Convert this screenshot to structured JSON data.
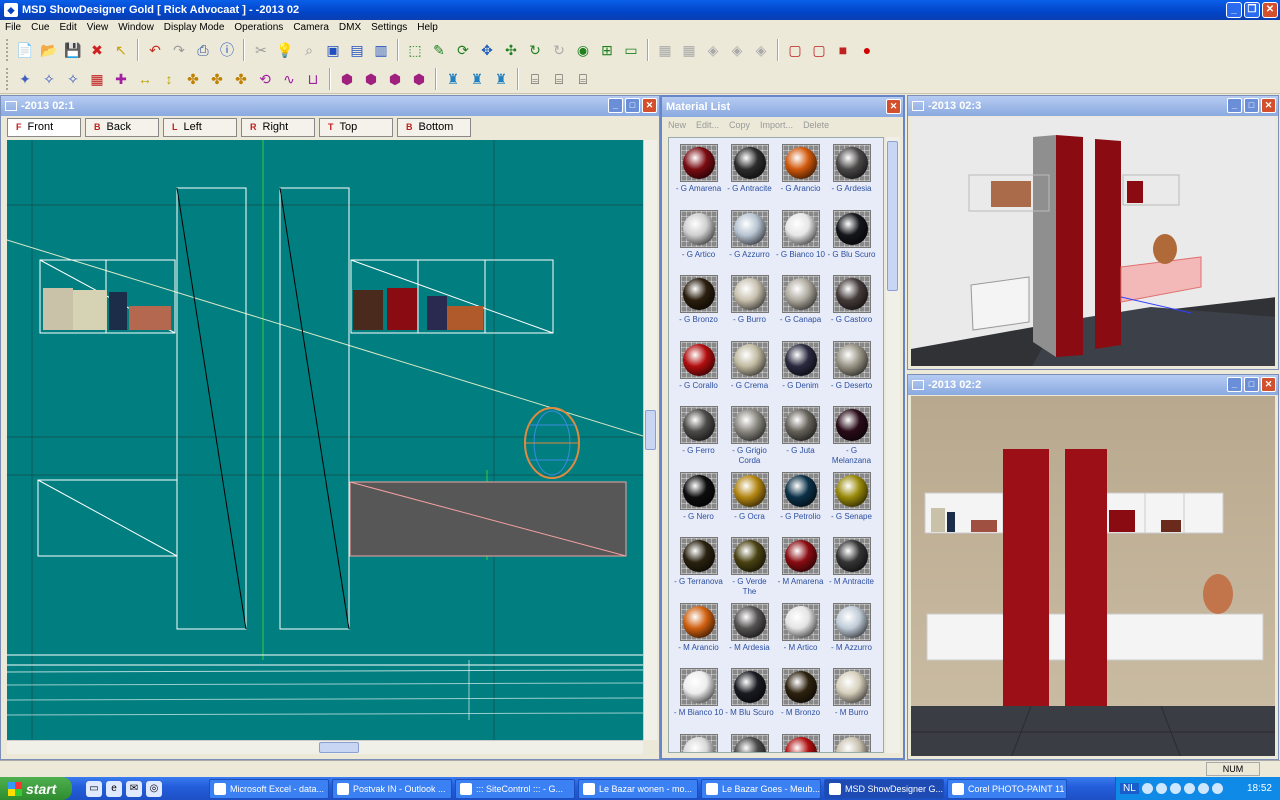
{
  "app": {
    "title": "MSD ShowDesigner Gold [  Rick Advocaat ] - -2013 02",
    "window_buttons": [
      "_",
      "❐",
      "✕"
    ]
  },
  "menu": [
    "File",
    "Cue",
    "Edit",
    "View",
    "Window",
    "Display Mode",
    "Operations",
    "Camera",
    "DMX",
    "Settings",
    "Help"
  ],
  "toolbar1_icons": [
    "new-file-icon",
    "open-folder-icon",
    "save-icon",
    "delete-icon",
    "pointer-icon",
    "undo-icon",
    "redo-icon",
    "print-icon",
    "info-icon",
    "cut-icon",
    "bulb-icon",
    "search-icon",
    "document-icon",
    "camera-doc-icon",
    "book-icon",
    "select-rect-icon",
    "pencil-select-icon",
    "rotate-icon",
    "move-icon",
    "pan-icon",
    "refresh-icon",
    "refresh-disabled-icon",
    "eye-icon",
    "split-view-icon",
    "display-mode-icon",
    "box-icon",
    "box2-icon",
    "shape-icon",
    "shape2-icon",
    "shape3-icon",
    "cube-outline-icon",
    "cube-wire-icon",
    "cube-solid-icon",
    "record-icon"
  ],
  "toolbar2_icons": [
    "fixture-tool-icon",
    "light-tool-icon",
    "light2-icon",
    "grid-tool-icon",
    "move-x-icon",
    "move-h-icon",
    "move-v-icon",
    "align-icon",
    "align2-icon",
    "align3-icon",
    "rotate-tool-icon",
    "path-icon",
    "chart-tool-icon",
    "object-icon",
    "object2-icon",
    "object3-icon",
    "object4-icon",
    "figure-icon",
    "figure2-icon",
    "figure3-icon",
    "truss-icon",
    "truss2-icon",
    "truss3-icon"
  ],
  "viewport1": {
    "title": "-2013 02:1",
    "tabs": [
      {
        "label": "Front",
        "icon": "F"
      },
      {
        "label": "Back",
        "icon": "B"
      },
      {
        "label": "Left",
        "icon": "L"
      },
      {
        "label": "Right",
        "icon": "R"
      },
      {
        "label": "Top",
        "icon": "T"
      },
      {
        "label": "Bottom",
        "icon": "B"
      }
    ]
  },
  "material_list": {
    "title": "Material List",
    "actions": [
      "New",
      "Edit...",
      "Copy",
      "Import...",
      "Delete"
    ],
    "items": [
      {
        "label": "- G Amarena",
        "color": "#7a0c12"
      },
      {
        "label": "- G Antracite",
        "color": "#2d2d2d"
      },
      {
        "label": "- G Arancio",
        "color": "#d2590c"
      },
      {
        "label": "- G Ardesia",
        "color": "#4b4848"
      },
      {
        "label": "- G Artico",
        "color": "#cfcfcf"
      },
      {
        "label": "- G Azzurro",
        "color": "#b7c4d2"
      },
      {
        "label": "- G Bianco 10",
        "color": "#e6e6e6"
      },
      {
        "label": "- G Blu Scuro",
        "color": "#15161c"
      },
      {
        "label": "- G Bronzo",
        "color": "#2a1e0e"
      },
      {
        "label": "- G Burro",
        "color": "#c9c2b0"
      },
      {
        "label": "- G Canapa",
        "color": "#b0aba0"
      },
      {
        "label": "- G Castoro",
        "color": "#453c3a"
      },
      {
        "label": "- G Corallo",
        "color": "#b20e0e"
      },
      {
        "label": "- G Crema",
        "color": "#c2bba2"
      },
      {
        "label": "- G Denim",
        "color": "#2a2a40"
      },
      {
        "label": "- G Deserto",
        "color": "#9a9586"
      },
      {
        "label": "- G Ferro",
        "color": "#4e4c49"
      },
      {
        "label": "- G Grigio Corda",
        "color": "#8c8a82"
      },
      {
        "label": "- G Juta",
        "color": "#66635b"
      },
      {
        "label": "- G Melanzana",
        "color": "#2a0c18"
      },
      {
        "label": "- G Nero",
        "color": "#0d0d0d"
      },
      {
        "label": "- G Ocra",
        "color": "#b38612"
      },
      {
        "label": "- G Petrolio",
        "color": "#0b3148"
      },
      {
        "label": "- G Senape",
        "color": "#9a8a0a"
      },
      {
        "label": "- G Terranova",
        "color": "#2a2210"
      },
      {
        "label": "- G Verde The",
        "color": "#4a4212"
      },
      {
        "label": "- M Amarena",
        "color": "#8a0c12"
      },
      {
        "label": "- M Antracite",
        "color": "#353535"
      },
      {
        "label": "- M Arancio",
        "color": "#d06010"
      },
      {
        "label": "- M Ardesia",
        "color": "#555252"
      },
      {
        "label": "- M Artico",
        "color": "#e4e4e4"
      },
      {
        "label": "- M Azzurro",
        "color": "#c0ccd8"
      },
      {
        "label": "- M Bianco 10",
        "color": "#ededed"
      },
      {
        "label": "- M Blu Scuro",
        "color": "#1a1b22"
      },
      {
        "label": "- M Bronzo",
        "color": "#2e220f"
      },
      {
        "label": "- M Burro",
        "color": "#d6cfbc"
      }
    ],
    "partial_row_colors": [
      "#d8d8d8",
      "#4a4a4a",
      "#b01010",
      "#c9c2b0"
    ]
  },
  "viewport3": {
    "title": "-2013 02:3"
  },
  "viewport2": {
    "title": "-2013 02:2"
  },
  "status": {
    "num": "NUM"
  },
  "taskbar": {
    "start": "start",
    "quick_launch": [
      "desktop-icon",
      "ie-icon",
      "outlook-icon",
      "chrome-icon"
    ],
    "tasks": [
      {
        "label": "Microsoft Excel - data...",
        "icon": "excel-icon"
      },
      {
        "label": "Postvak IN - Outlook ...",
        "icon": "outlook-icon"
      },
      {
        "label": "::: SiteControl ::: - G...",
        "icon": "chrome-icon"
      },
      {
        "label": "Le Bazar wonen - mo...",
        "icon": "chrome-icon"
      },
      {
        "label": "Le Bazar Goes - Meub...",
        "icon": "chrome-icon"
      },
      {
        "label": "MSD ShowDesigner G...",
        "icon": "msd-icon",
        "active": true
      },
      {
        "label": "Corel PHOTO-PAINT 11",
        "icon": "corel-icon"
      }
    ],
    "lang": "NL",
    "clock": "18:52"
  }
}
